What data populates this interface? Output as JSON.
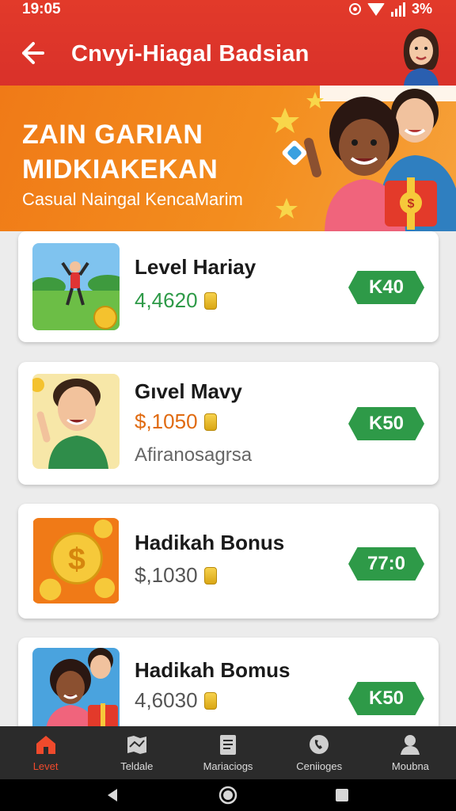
{
  "status": {
    "time": "19:05",
    "battery": "3%"
  },
  "appbar": {
    "title": "Cnvyi-Hiagal Badsian"
  },
  "banner": {
    "line1": "ZAIN GARIAN",
    "line2": "MIDKIAKEKAN",
    "subtitle": "Casual Naingal KencaMarim"
  },
  "cards": [
    {
      "name": "Level Hariay",
      "amount": "4,4620",
      "amount_color": "#2e9a48",
      "extra": "",
      "reward": "K40"
    },
    {
      "name": "Gıvel Mavy",
      "amount": "$,1050",
      "amount_color": "#e06a10",
      "extra": "Afiranosagrsa",
      "reward": "K50"
    },
    {
      "name": "Hadikah Bonus",
      "amount": "$,1030",
      "amount_color": "#555555",
      "extra": "",
      "reward": "77:0"
    },
    {
      "name": "Hadikah Bomus",
      "amount": "4,6030",
      "amount_color": "#555555",
      "extra": "",
      "reward": "K50"
    }
  ],
  "nav": [
    {
      "label": "Levet",
      "icon": "home-icon",
      "active": true
    },
    {
      "label": "Teldale",
      "icon": "map-icon",
      "active": false
    },
    {
      "label": "Mariaciogs",
      "icon": "document-icon",
      "active": false
    },
    {
      "label": "Ceniioges",
      "icon": "phone-icon",
      "active": false
    },
    {
      "label": "Moubna",
      "icon": "profile-icon",
      "active": false
    }
  ],
  "colors": {
    "primary": "#e23a2a",
    "banner": "#f07a17",
    "accent_green": "#2e9a48",
    "nav_bg": "#2b2b2b"
  }
}
